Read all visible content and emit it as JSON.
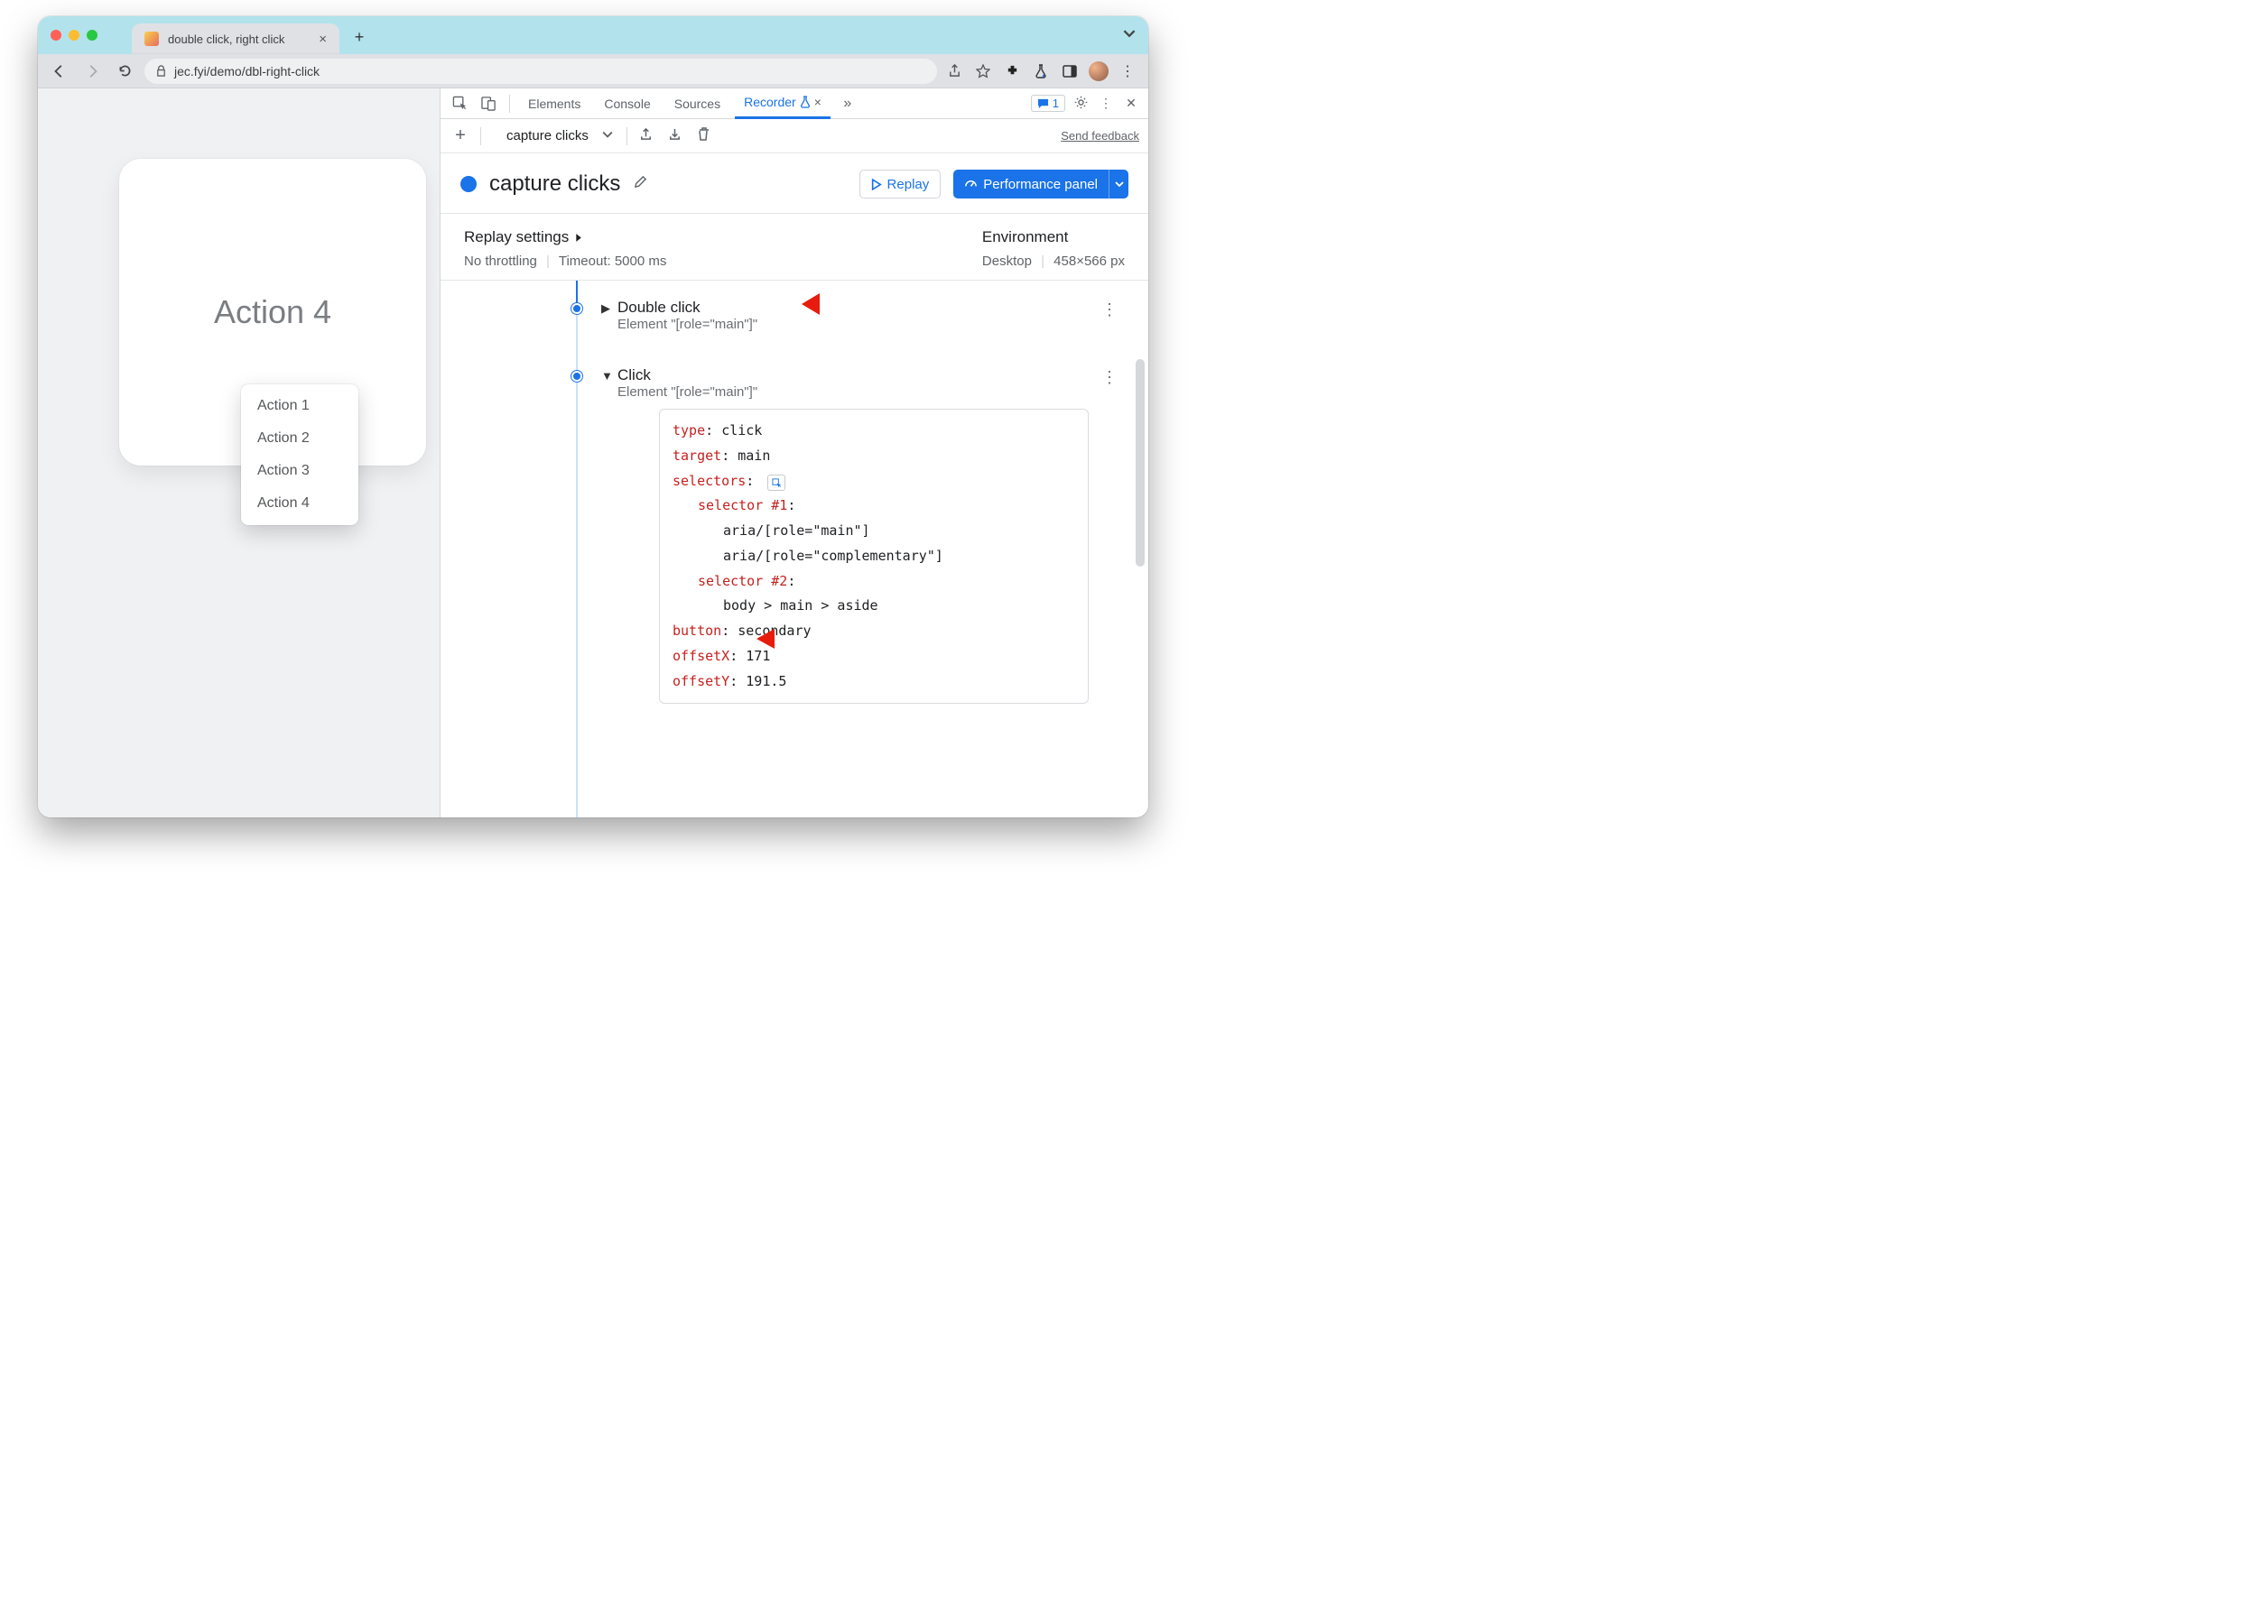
{
  "tab": {
    "title": "double click, right click"
  },
  "address": {
    "url": "jec.fyi/demo/dbl-right-click"
  },
  "page": {
    "card_title": "Action 4",
    "menu": [
      "Action 1",
      "Action 2",
      "Action 3",
      "Action 4"
    ]
  },
  "devtools": {
    "tabs": {
      "elements": "Elements",
      "console": "Console",
      "sources": "Sources",
      "recorder": "Recorder"
    },
    "issues_count": "1",
    "toolbar": {
      "recording_name": "capture clicks",
      "feedback": "Send feedback"
    },
    "header": {
      "title": "capture clicks",
      "replay": "Replay",
      "perf": "Performance panel"
    },
    "settings": {
      "replay_label": "Replay settings",
      "throttling": "No throttling",
      "timeout": "Timeout: 5000 ms",
      "env_label": "Environment",
      "device": "Desktop",
      "dims": "458×566 px"
    },
    "steps": [
      {
        "title": "Double click",
        "sub": "Element \"[role=\"main\"]\""
      },
      {
        "title": "Click",
        "sub": "Element \"[role=\"main\"]\""
      }
    ],
    "detail": {
      "type_k": "type",
      "type_v": "click",
      "target_k": "target",
      "target_v": "main",
      "selectors_k": "selectors",
      "sel1_k": "selector #1",
      "sel1a": "aria/[role=\"main\"]",
      "sel1b": "aria/[role=\"complementary\"]",
      "sel2_k": "selector #2",
      "sel2a": "body > main > aside",
      "button_k": "button",
      "button_v": "secondary",
      "ox_k": "offsetX",
      "ox_v": "171",
      "oy_k": "offsetY",
      "oy_v": "191.5"
    }
  }
}
